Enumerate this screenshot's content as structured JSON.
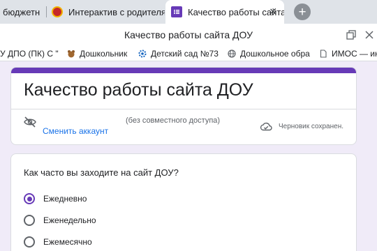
{
  "browser": {
    "tabs": [
      {
        "label": "бюджетн",
        "icon": "google-icon"
      },
      {
        "label": "Интерактив с родителями",
        "icon": "crest-icon"
      },
      {
        "label": "Качество работы сайта",
        "icon": "forms-icon",
        "active": true
      }
    ],
    "close_symbol": "✕",
    "new_tab_symbol": "+",
    "page_title": "Качество работы сайта ДОУ",
    "bookmarks": [
      {
        "label": "У ДПО (ПК) С \"У",
        "icon": "page-icon"
      },
      {
        "label": "Дошкольник",
        "icon": "bear-icon"
      },
      {
        "label": "Детский сад №73",
        "icon": "gear-icon"
      },
      {
        "label": "Дошкольное обра",
        "icon": "globe-icon"
      },
      {
        "label": "ИМОС — ин",
        "icon": "document-icon"
      }
    ]
  },
  "form": {
    "accent_color": "#673ab7",
    "title": "Качество работы сайта ДОУ",
    "switch_account": "Сменить аккаунт",
    "sharing_status": "(без совместного доступа)",
    "draft_status": "Черновик сохранен.",
    "question": {
      "text": "Как часто вы заходите на сайт ДОУ?",
      "options": [
        "Ежедневно",
        "Еженедельно",
        "Ежемесячно"
      ],
      "selected": "Ежедневно"
    }
  }
}
